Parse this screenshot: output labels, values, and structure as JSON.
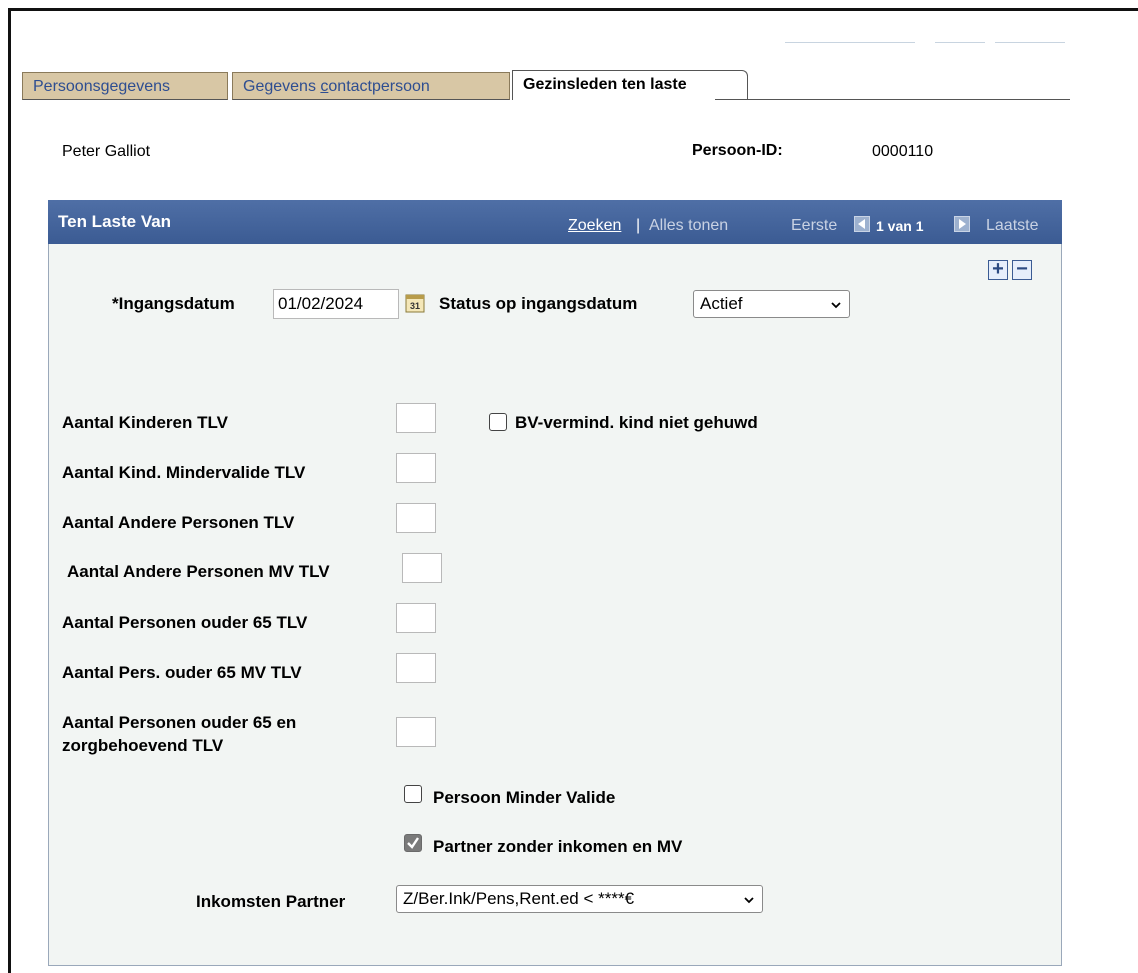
{
  "tabs": [
    {
      "label_pre": "Persoonsgegevens",
      "label_u": "",
      "label_post": ""
    },
    {
      "label_pre": "Gegevens ",
      "label_u": "c",
      "label_post": "ontactpersoon"
    },
    {
      "label_pre": "Gezinsleden ten laste",
      "label_u": "",
      "label_post": ""
    }
  ],
  "person": {
    "name": "Peter Galliot",
    "id_label": "Persoon-ID:",
    "id_value": "0000110"
  },
  "panel": {
    "title": "Ten Laste Van",
    "search_link": "Zoeken",
    "separator": "|",
    "show_all": "Alles tonen",
    "first": "Eerste",
    "page_info": "1 van 1",
    "last": "Laatste"
  },
  "form": {
    "effective_date_label": "*Ingangsdatum",
    "effective_date_value": "01/02/2024",
    "status_label": "Status op ingangsdatum",
    "status_value": "Actief",
    "fields": [
      {
        "label": "Aantal Kinderen TLV",
        "value": ""
      },
      {
        "label": "Aantal Kind. Mindervalide TLV",
        "value": ""
      },
      {
        "label": "Aantal Andere Personen TLV",
        "value": ""
      },
      {
        "label": "Aantal Andere Personen MV TLV",
        "value": ""
      },
      {
        "label": "Aantal Personen ouder 65 TLV",
        "value": ""
      },
      {
        "label": "Aantal Pers. ouder 65 MV TLV",
        "value": ""
      },
      {
        "label_line1": "Aantal Personen ouder 65 en",
        "label_line2": "zorgbehoevend TLV",
        "value": ""
      }
    ],
    "bv_checkbox_label": "BV-vermind. kind niet gehuwd",
    "bv_checked": false,
    "minder_valide_label": "Persoon Minder Valide",
    "minder_valide_checked": false,
    "partner_label": "Partner zonder inkomen en MV",
    "partner_checked": true,
    "income_partner_label": "Inkomsten Partner",
    "income_partner_value": "Z/Ber.Ink/Pens,Rent.ed < ****€"
  },
  "icons": {
    "calendar": "calendar-icon",
    "add": "plus-icon",
    "remove": "minus-icon",
    "prev": "arrow-left-icon",
    "next": "arrow-right-icon",
    "dropdown": "chevron-down-icon"
  },
  "colors": {
    "header_bg": "#3b5b93",
    "tab_inactive_bg": "#d8c7a5",
    "link_color": "#2e4e91",
    "panel_bg": "#f2f5f3"
  }
}
